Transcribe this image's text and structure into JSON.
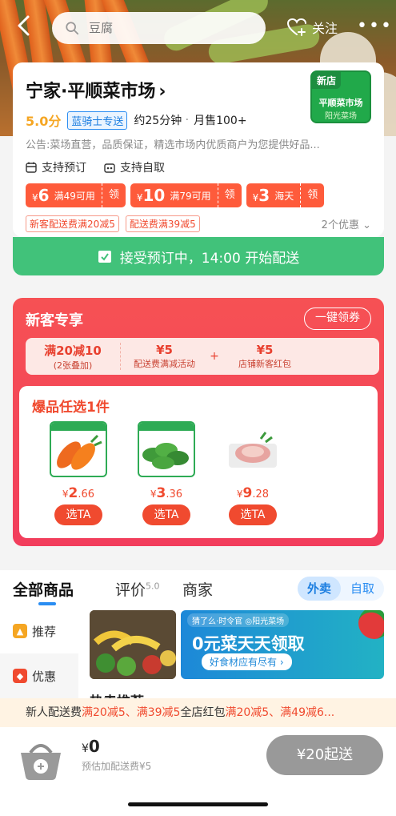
{
  "topbar": {
    "search_placeholder": "豆腐",
    "follow_label": "关注",
    "more_label": "•••"
  },
  "store": {
    "name": "宁家·平顺菜市场",
    "score": "5.0分",
    "rider_badge": "蓝骑士专送",
    "delivery_time": "约25分钟",
    "monthly_sales": "月售100+",
    "notice": "公告:菜场直营，品质保证，精选市场内优质商户为您提供好品...",
    "features": [
      "支持预订",
      "支持自取"
    ],
    "logo": {
      "tag": "新店",
      "name": "平顺菜市场",
      "brand": "阳光菜场"
    },
    "coupons": [
      {
        "amount": "6",
        "condition": "满49可用",
        "action": "领"
      },
      {
        "amount": "10",
        "condition": "满79可用",
        "action": "领"
      },
      {
        "amount": "3",
        "condition": "海天",
        "action": "领"
      }
    ],
    "promos": [
      "新客配送费满20减5",
      "配送费满39减5"
    ],
    "promo_count": "2个优惠"
  },
  "preorder": {
    "text": "接受预订中，14:00 开始配送"
  },
  "newcomer": {
    "title": "新客专享",
    "get_all": "一键领券",
    "offers": [
      {
        "big": "满20减10",
        "small": "(2张叠加)"
      },
      {
        "big": "¥5",
        "small": "配送费满减活动"
      },
      {
        "big": "¥5",
        "small": "店铺新客红包"
      }
    ],
    "plus": "+",
    "pick_title": "爆品任选1件",
    "products": [
      {
        "name": "carrot",
        "yuan": "2",
        "cents": ".66",
        "button": "选TA"
      },
      {
        "name": "spinach",
        "yuan": "3",
        "cents": ".36",
        "button": "选TA"
      },
      {
        "name": "pork",
        "yuan": "9",
        "cents": ".28",
        "button": "选TA"
      }
    ],
    "currency": "¥"
  },
  "tabs": {
    "all": "全部商品",
    "reviews": "评价",
    "reviews_score": "5.0",
    "merchant": "商家",
    "delivery": "外卖",
    "pickup": "自取"
  },
  "sidebar": {
    "items": [
      {
        "label": "推荐"
      },
      {
        "label": "优惠"
      }
    ]
  },
  "banner": {
    "tag": "猜了么·时令官  ◎阳光菜场",
    "headline": "0元菜天天领取",
    "pill": "好食材应有尽有 ›"
  },
  "hot_title": "热卖推荐",
  "promo_strip": {
    "lead": "新人配送费",
    "a": "满20减5、满39减5",
    "mid": "全店红包",
    "b": "满20减5、满49减6..."
  },
  "cart": {
    "total_symbol": "¥",
    "total": "0",
    "fee_note": "预估加配送费¥5",
    "start_button": "¥20起送"
  },
  "colors": {
    "accent_red": "#f04a2f",
    "accent_blue": "#2a8df2",
    "preorder_green": "#41c27a",
    "coupon_red": "#fe5b3b"
  }
}
